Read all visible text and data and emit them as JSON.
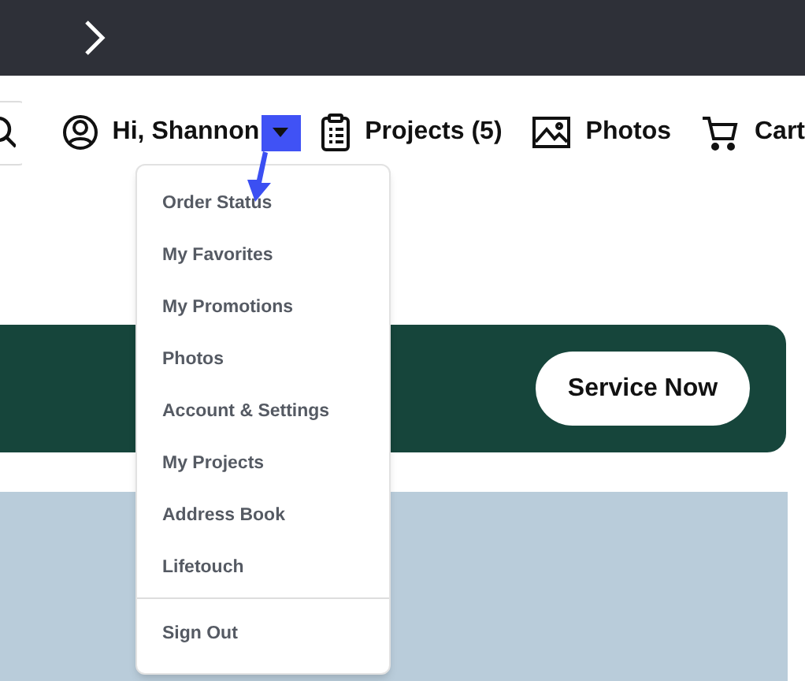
{
  "header": {
    "account": {
      "greeting": "Hi, Shannon",
      "expanded": true
    },
    "links": [
      {
        "kind": "projects",
        "label": "Projects (5)"
      },
      {
        "kind": "photos",
        "label": "Photos"
      },
      {
        "kind": "cart",
        "label": "Cart"
      }
    ]
  },
  "account_menu": {
    "items": [
      "Order Status",
      "My Favorites",
      "My Promotions",
      "Photos",
      "Account & Settings",
      "My Projects",
      "Address Book",
      "Lifetouch"
    ],
    "footer_item": "Sign Out"
  },
  "banner": {
    "button": "Service Now"
  }
}
